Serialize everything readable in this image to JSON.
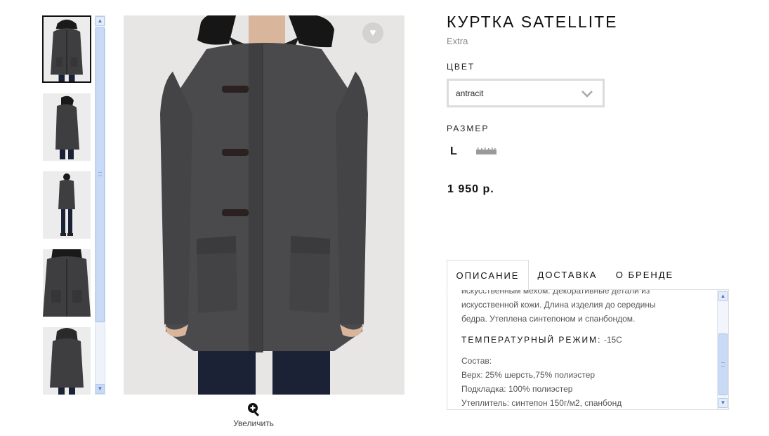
{
  "product": {
    "title": "КУРТКА SATELLITE",
    "brand": "Extra",
    "color_label": "ЦВЕТ",
    "color_value": "antracit",
    "size_label": "РАЗМЕР",
    "size_value": "L",
    "price": "1 950 р."
  },
  "gallery": {
    "zoom_label": "Увеличить",
    "thumbnails": [
      {
        "view": "front-hood",
        "active": true
      },
      {
        "view": "side",
        "active": false
      },
      {
        "view": "full-front",
        "active": false
      },
      {
        "view": "close-front",
        "active": false
      },
      {
        "view": "back",
        "active": false
      }
    ]
  },
  "tabs": [
    {
      "label": "ОПИСАНИЕ",
      "active": true
    },
    {
      "label": "ДОСТАВКА",
      "active": false
    },
    {
      "label": "О БРЕНДЕ",
      "active": false
    }
  ],
  "description": {
    "line1": "искусственным мехом. Декоративные детали из",
    "line2": "искусственной кожи. Длина изделия до середины",
    "line3": "бедра. Утеплена синтепоном и спанбондом.",
    "temp_label": "ТЕМПЕРАТУРНЫЙ РЕЖИМ:",
    "temp_value": "-15С",
    "composition_title": "Состав:",
    "top": "Верх: 25% шерсть,75% полиэстер",
    "lining": "Подкладка: 100% полиэстер",
    "insulation": "Утеплитель: синтепон 150г/м2, спанбонд"
  },
  "icons": {
    "favorite": "heart-icon",
    "zoom": "zoom-in-icon",
    "dropdown": "chevron-down-icon",
    "size_guide": "ruler-icon",
    "scroll_up": "arrow-up-icon",
    "scroll_down": "arrow-down-icon"
  },
  "colors": {
    "jacket": "#4a4a4c",
    "background_photo": "#e7e6e5",
    "scrollbar": "#c9daf6"
  }
}
